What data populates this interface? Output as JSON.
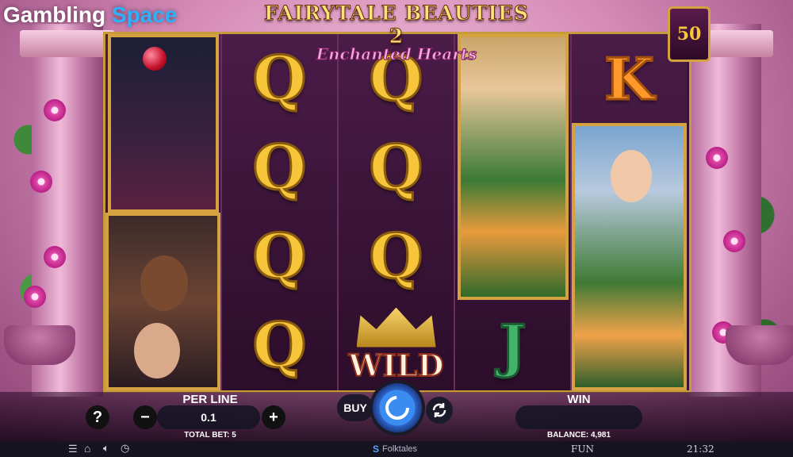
{
  "watermark": {
    "part1": "Gambling",
    "part2": "Space"
  },
  "game": {
    "title": "FAIRYTALE BEAUTIES 2",
    "subtitle": "Enchanted Hearts",
    "lines": "50"
  },
  "reels": {
    "reel2": [
      "Q",
      "Q",
      "Q",
      "Q"
    ],
    "reel3": [
      "Q",
      "Q",
      "Q",
      "WILD"
    ],
    "reel4_bottom": "J",
    "reel5_top": "K"
  },
  "controls": {
    "help_label": "?",
    "per_line_label": "PER LINE",
    "per_line_value": "0.1",
    "minus_label": "−",
    "plus_label": "+",
    "total_bet_label": "TOTAL BET: 5",
    "buy_label": "BUY",
    "win_label": "WIN",
    "win_value": "",
    "balance_label": "BALANCE: 4,981"
  },
  "status_bar": {
    "provider": "Folktales",
    "mode": "FUN",
    "clock": "21:32"
  },
  "colors": {
    "gold": "#f6c53a",
    "frame": "#c79a3b",
    "spin_blue": "#2d63c9"
  }
}
